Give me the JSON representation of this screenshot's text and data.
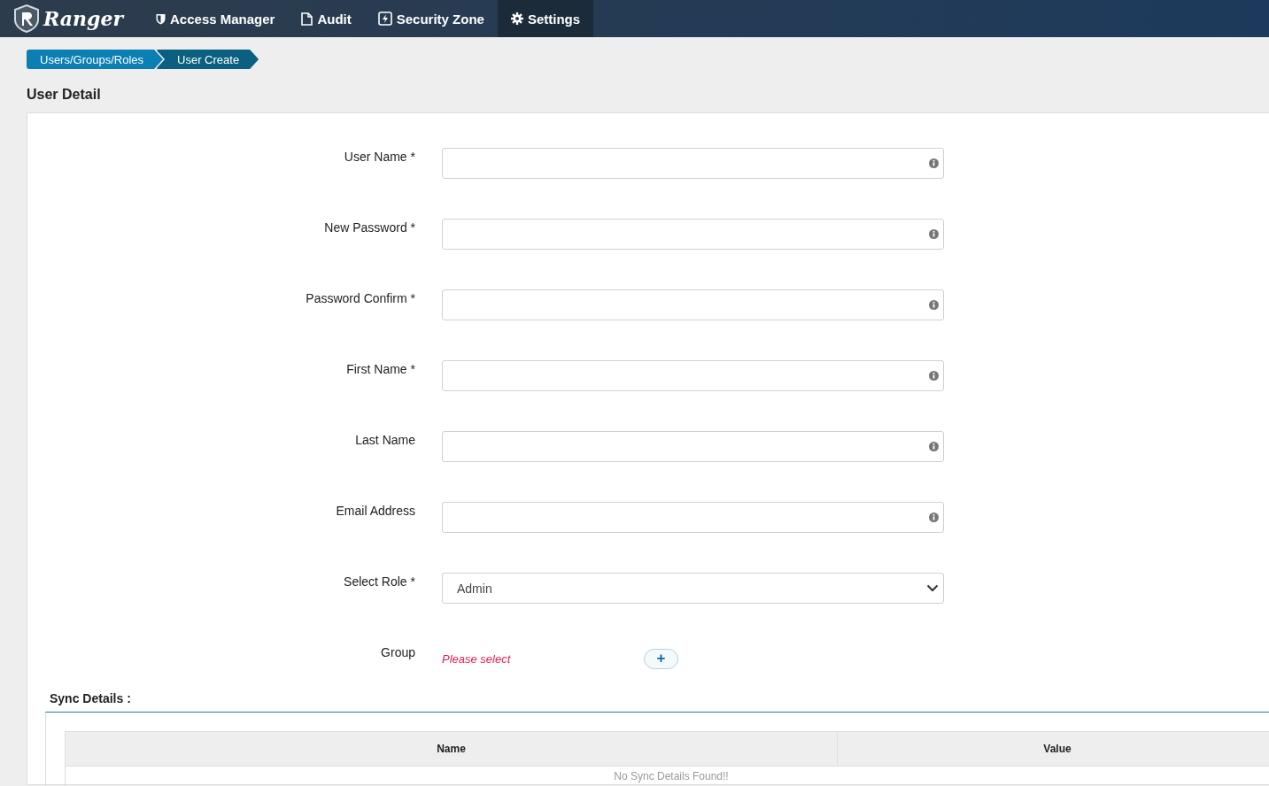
{
  "header": {
    "brand": "Ranger",
    "nav": [
      {
        "label": "Access Manager",
        "selected": false
      },
      {
        "label": "Audit",
        "selected": false
      },
      {
        "label": "Security Zone",
        "selected": false
      },
      {
        "label": "Settings",
        "selected": true
      }
    ]
  },
  "breadcrumb": [
    "Users/Groups/Roles",
    "User Create"
  ],
  "title": "User Detail",
  "form": {
    "fields": [
      {
        "label": "User Name *",
        "kind": "text"
      },
      {
        "label": "New Password *",
        "kind": "text"
      },
      {
        "label": "Password Confirm *",
        "kind": "text"
      },
      {
        "label": "First Name *",
        "kind": "text"
      },
      {
        "label": "Last Name",
        "kind": "text"
      },
      {
        "label": "Email Address",
        "kind": "text"
      },
      {
        "label": "Select Role *",
        "kind": "select",
        "value": "Admin"
      },
      {
        "label": "Group",
        "kind": "group",
        "placeholder": "Please select",
        "button": "+"
      }
    ]
  },
  "sync": {
    "title": "Sync Details :",
    "columns": [
      "Name",
      "Value"
    ],
    "empty": "No Sync Details Found!!"
  }
}
